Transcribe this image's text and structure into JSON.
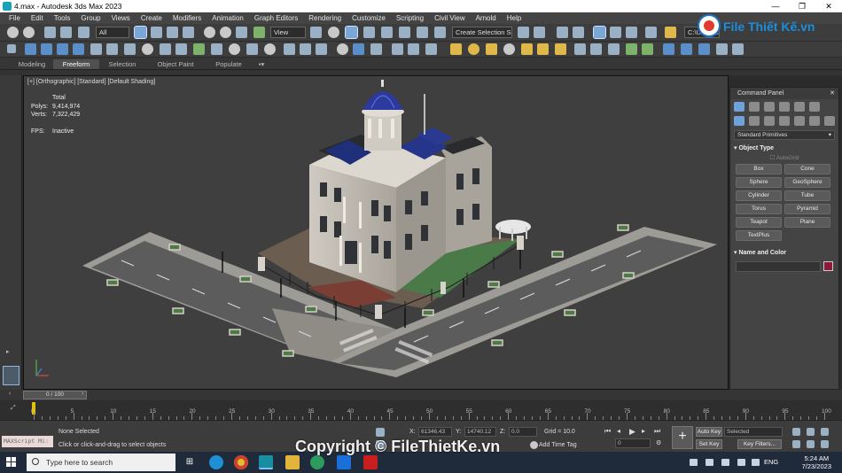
{
  "window": {
    "title": "4.max - Autodesk 3ds Max 2023"
  },
  "menu": [
    "File",
    "Edit",
    "Tools",
    "Group",
    "Views",
    "Create",
    "Modifiers",
    "Animation",
    "Graph Editors",
    "Rendering",
    "Customize",
    "Scripting",
    "Civil View",
    "Arnold",
    "Help"
  ],
  "toolbar": {
    "selection_filter": "All",
    "ref_coord": "View",
    "named_selection": "Create Selection Se",
    "project_path": "C:\\Users\\Lin"
  },
  "ribbon_tabs": [
    "Modeling",
    "Freeform",
    "Selection",
    "Object Paint",
    "Populate"
  ],
  "ribbon_active": "Freeform",
  "viewport": {
    "label": "[+] [Orthographic] [Standard] [Default Shading]",
    "stats": {
      "total_label": "Total",
      "polys_label": "Polys:",
      "polys": "9,414,974",
      "verts_label": "Verts:",
      "verts": "7,322,429",
      "fps_label": "FPS:",
      "fps": "Inactive"
    }
  },
  "command_panel": {
    "title": "Command Panel",
    "close": "✕",
    "dropdown": "Standard Primitives",
    "object_type": "Object Type",
    "autogrid": "AutoGrid",
    "buttons": [
      "Box",
      "Cone",
      "Sphere",
      "GeoSphere",
      "Cylinder",
      "Tube",
      "Torus",
      "Pyramid",
      "Teapot",
      "Plane",
      "TextPlus"
    ],
    "name_and_color": "Name and Color",
    "object_color": "#8e1a3a"
  },
  "timeline": {
    "slider": "0 / 100",
    "ticks": [
      "0",
      "5",
      "10",
      "15",
      "20",
      "25",
      "30",
      "35",
      "40",
      "45",
      "50",
      "55",
      "60",
      "65",
      "70",
      "75",
      "80",
      "85",
      "90",
      "95",
      "100"
    ]
  },
  "status": {
    "maxscript": "MAXScript Mi:",
    "selection": "None Selected",
    "prompt": "Click or click-and-drag to select objects",
    "x_label": "X:",
    "x": "61346.43",
    "y_label": "Y:",
    "y": "14740.12",
    "z_label": "Z:",
    "z": "0.0",
    "grid": "Grid = 10.0",
    "add_time_tag": "Add Time Tag",
    "frame": "0",
    "auto_key": "Auto Key",
    "set_key": "Set Key",
    "key_mode": "Selected",
    "key_filters": "Key Filters..."
  },
  "taskbar": {
    "search_placeholder": "Type here to search",
    "lang": "ENG",
    "time": "5:24 AM",
    "date": "7/23/2023"
  },
  "watermark": {
    "logo": "File Thiết Kế.vn",
    "copyright": "Copyright © FileThietKe.vn"
  }
}
